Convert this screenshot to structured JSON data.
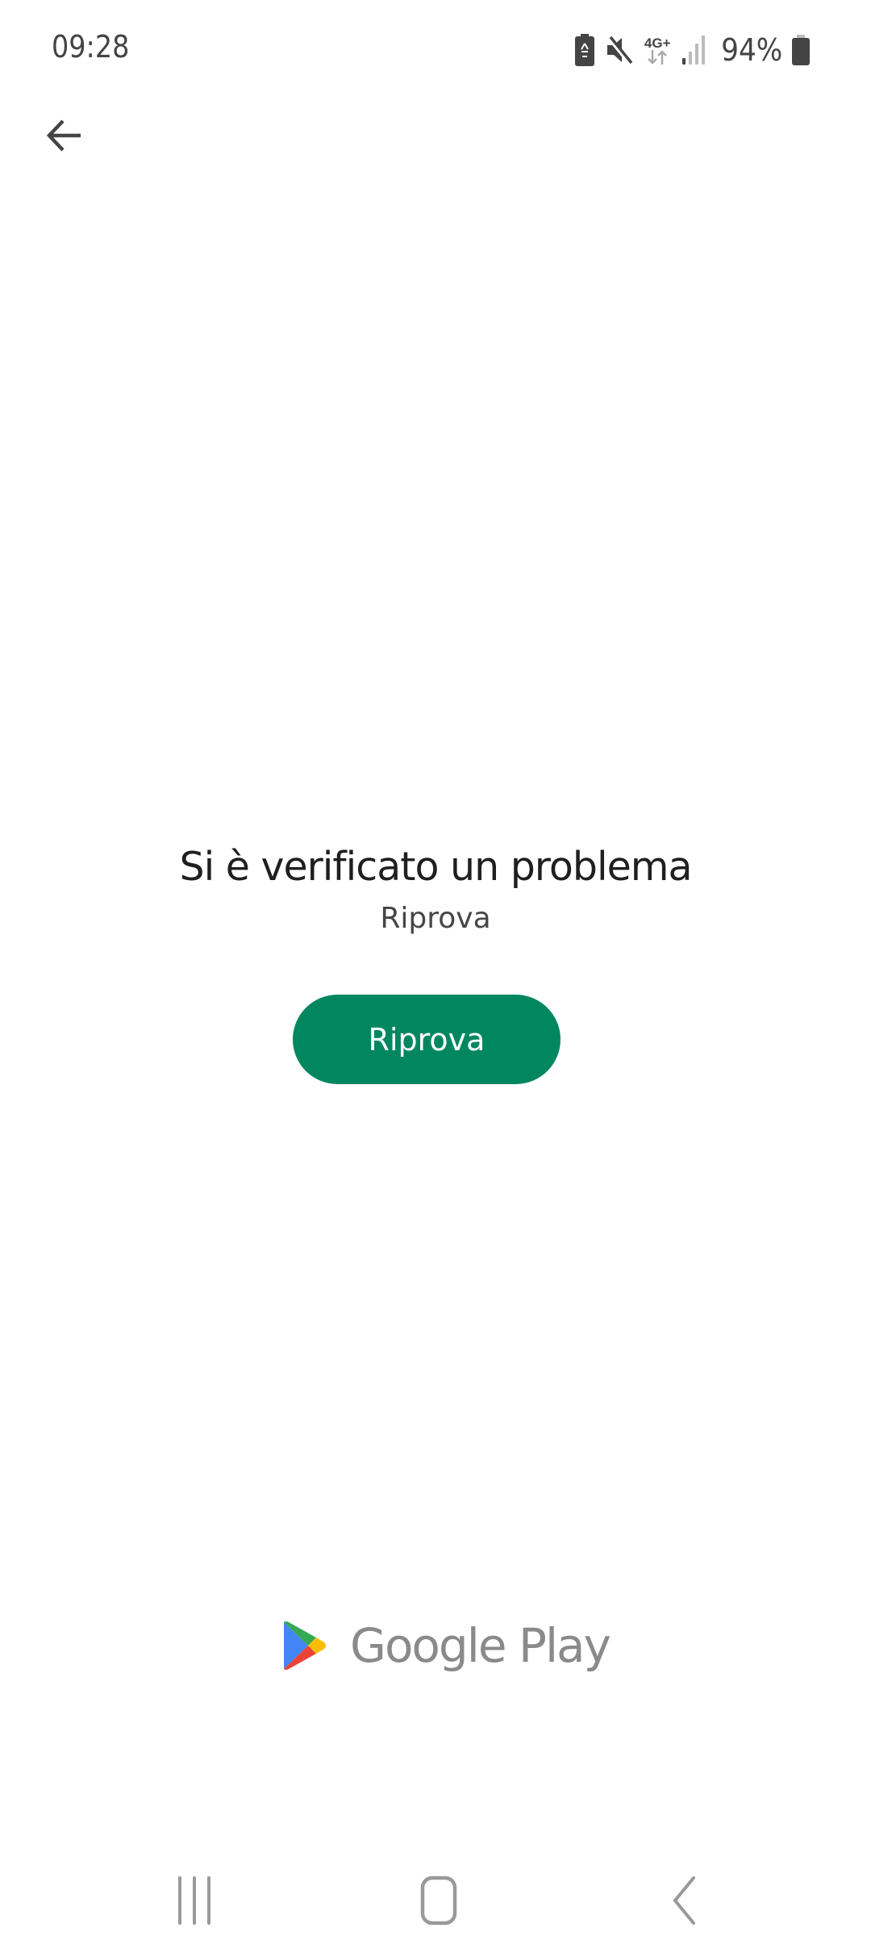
{
  "status_bar": {
    "time": "09:28",
    "icons": [
      "battery-saver-icon",
      "mute-icon",
      "network-4g-plus-icon",
      "signal-icon",
      "battery-icon"
    ],
    "network_label": "4G+",
    "battery_percent": "94%"
  },
  "header": {
    "back_icon": "arrow-back-icon"
  },
  "error": {
    "title": "Si è verificato un problema",
    "subtitle": "Riprova",
    "retry_button_label": "Riprova"
  },
  "branding": {
    "logo_icon": "google-play-logo-icon",
    "name": "Google Play"
  },
  "navigation_bar": {
    "recents_icon": "recents-icon",
    "home_icon": "home-icon",
    "back_icon": "back-icon"
  },
  "colors": {
    "accent": "#01875f",
    "text_primary": "#1f1f1f",
    "text_secondary": "#444746",
    "brand_gray": "#8a8a8a",
    "play_green": "#34a853",
    "play_blue": "#4285f4",
    "play_yellow": "#fbbc04",
    "play_red": "#ea4335"
  }
}
